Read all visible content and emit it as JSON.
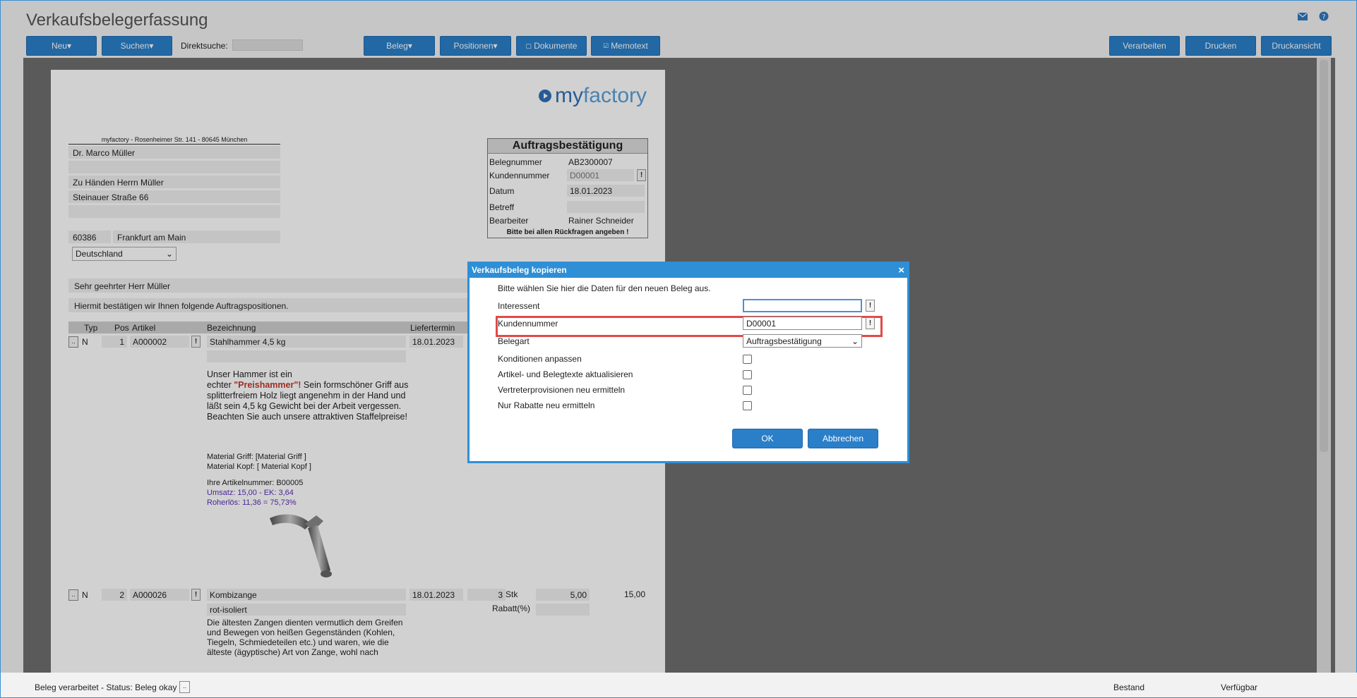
{
  "app": {
    "title": "Verkaufsbelegerfassung"
  },
  "toolbar": {
    "neu": "Neu",
    "suchen": "Suchen",
    "direktsuche_label": "Direktsuche:",
    "beleg": "Beleg",
    "positionen": "Positionen",
    "dokumente": "Dokumente",
    "memotext": "Memotext",
    "verarbeiten": "Verarbeiten",
    "drucken": "Drucken",
    "druckansicht": "Druckansicht"
  },
  "document": {
    "logo_text_my": "my",
    "logo_text_factory": "factory",
    "sender_line": "myfactory - Rosenheimer Str. 141 - 80645 München",
    "address": {
      "name": "Dr. Marco Müller",
      "attention": "Zu Händen Herrn Müller",
      "street": "Steinauer Straße 66",
      "zip": "60386",
      "city": "Frankfurt am Main",
      "country": "Deutschland"
    },
    "infobox": {
      "title": "Auftragsbestätigung",
      "belegnummer_label": "Belegnummer",
      "belegnummer": "AB2300007",
      "kundennummer_label": "Kundennummer",
      "kundennummer": "D00001",
      "datum_label": "Datum",
      "datum": "18.01.2023",
      "betreff_label": "Betreff",
      "betreff": "",
      "bearbeiter_label": "Bearbeiter",
      "bearbeiter": "Rainer Schneider",
      "note": "Bitte bei allen Rückfragen angeben !"
    },
    "greeting": "Sehr geehrter Herr Müller",
    "intro": "Hiermit bestätigen wir Ihnen folgende Auftragspositionen.",
    "table_headers": {
      "typ": "Typ",
      "pos": "Pos",
      "artikel": "Artikel",
      "bezeichnung": "Bezeichnung",
      "liefertermin": "Liefertermin"
    },
    "row1": {
      "typ": "N",
      "pos": "1",
      "artikel": "A000002",
      "bezeichnung": "Stahlhammer 4,5 kg",
      "liefertermin": "18.01.2023",
      "desc_a": "Unser Hammer ist ein",
      "desc_b": "echter ",
      "desc_red": "\"Preishammer\"!",
      "desc_c": " Sein formschöner Griff aus splitterfreiem Holz liegt angenehm in der Hand und läßt sein 4,5 kg Gewicht bei der Arbeit vergessen.",
      "desc_d": "Beachten Sie auch unsere attraktiven Staffelpreise!",
      "material_griff": "Material Griff: [Material Griff ]",
      "material_kopf": "Material Kopf: [ Material Kopf ]",
      "artikelnummer": "Ihre Artikelnummer: B00005",
      "umsatz": "Umsatz: 15,00 - EK: 3,64",
      "roherloes": "Roherlös: 11,36 = 75,73%"
    },
    "row2": {
      "typ": "N",
      "pos": "2",
      "artikel": "A000026",
      "bezeichnung": "Kombizange",
      "zusatz": "rot-isoliert",
      "liefertermin": "18.01.2023",
      "menge": "3",
      "einheit": "Stk",
      "preis": "5,00",
      "gesamt": "15,00",
      "rabatt_label": "Rabatt(%)",
      "desc": "Die ältesten Zangen dienten vermutlich dem Greifen und Bewegen von heißen Gegenständen (Kohlen, Tiegeln, Schmiedeteilen etc.) und waren, wie die älteste (ägyptische) Art von Zange, wohl nach"
    }
  },
  "dialog": {
    "title": "Verkaufsbeleg kopieren",
    "intro": "Bitte wählen Sie hier die Daten für den neuen Beleg aus.",
    "interessent_label": "Interessent",
    "interessent_value": "",
    "kundennummer_label": "Kundennummer",
    "kundennummer_value": "D00001",
    "belegart_label": "Belegart",
    "belegart_value": "Auftragsbestätigung",
    "konditionen_label": "Konditionen anpassen",
    "texte_label": "Artikel- und Belegtexte aktualisieren",
    "provisionen_label": "Vertreterprovisionen neu ermitteln",
    "rabatte_label": "Nur Rabatte neu ermitteln",
    "ok": "OK",
    "abbrechen": "Abbrechen"
  },
  "statusbar": {
    "text": "Beleg verarbeitet - Status: Beleg okay",
    "bestand": "Bestand",
    "verfuegbar": "Verfügbar"
  }
}
